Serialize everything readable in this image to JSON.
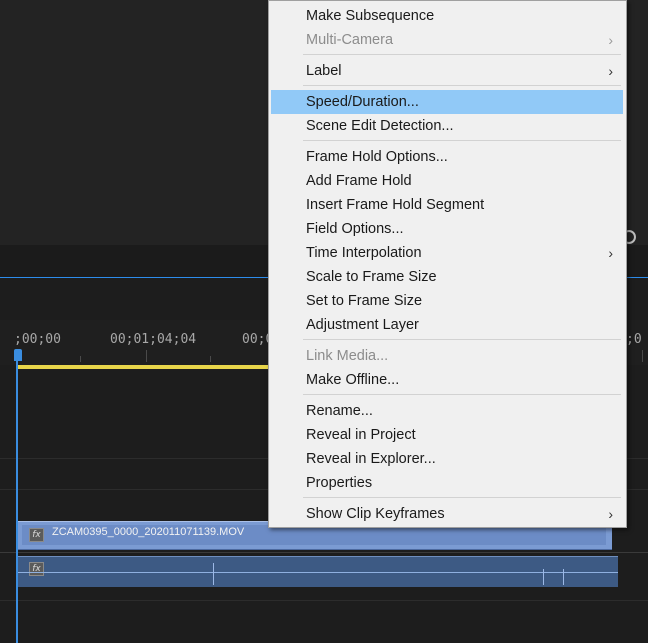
{
  "timeline": {
    "ruler_labels": [
      ";00;00",
      "00;01;04;04",
      "00;0",
      ";0"
    ],
    "video_clip_name": "ZCAM0395_0000_202011071139.MOV",
    "fx_label": "fx"
  },
  "colors": {
    "accent": "#2d8ceb",
    "work_area": "#e8d54a",
    "video_clip": "#7b9bd3",
    "menu_highlight": "#91c9f7"
  },
  "context_menu": {
    "items": [
      {
        "label": "Make Subsequence",
        "enabled": true,
        "submenu": false
      },
      {
        "label": "Multi-Camera",
        "enabled": false,
        "submenu": true
      },
      {
        "label": "Label",
        "enabled": true,
        "submenu": true
      },
      {
        "label": "Speed/Duration...",
        "enabled": true,
        "submenu": false,
        "highlighted": true
      },
      {
        "label": "Scene Edit Detection...",
        "enabled": true,
        "submenu": false
      },
      {
        "label": "Frame Hold Options...",
        "enabled": true,
        "submenu": false
      },
      {
        "label": "Add Frame Hold",
        "enabled": true,
        "submenu": false
      },
      {
        "label": "Insert Frame Hold Segment",
        "enabled": true,
        "submenu": false
      },
      {
        "label": "Field Options...",
        "enabled": true,
        "submenu": false
      },
      {
        "label": "Time Interpolation",
        "enabled": true,
        "submenu": true
      },
      {
        "label": "Scale to Frame Size",
        "enabled": true,
        "submenu": false
      },
      {
        "label": "Set to Frame Size",
        "enabled": true,
        "submenu": false
      },
      {
        "label": "Adjustment Layer",
        "enabled": true,
        "submenu": false
      },
      {
        "label": "Link Media...",
        "enabled": false,
        "submenu": false
      },
      {
        "label": "Make Offline...",
        "enabled": true,
        "submenu": false
      },
      {
        "label": "Rename...",
        "enabled": true,
        "submenu": false
      },
      {
        "label": "Reveal in Project",
        "enabled": true,
        "submenu": false
      },
      {
        "label": "Reveal in Explorer...",
        "enabled": true,
        "submenu": false
      },
      {
        "label": "Properties",
        "enabled": true,
        "submenu": false
      },
      {
        "label": "Show Clip Keyframes",
        "enabled": true,
        "submenu": true
      }
    ],
    "submenu_arrow": "›"
  }
}
